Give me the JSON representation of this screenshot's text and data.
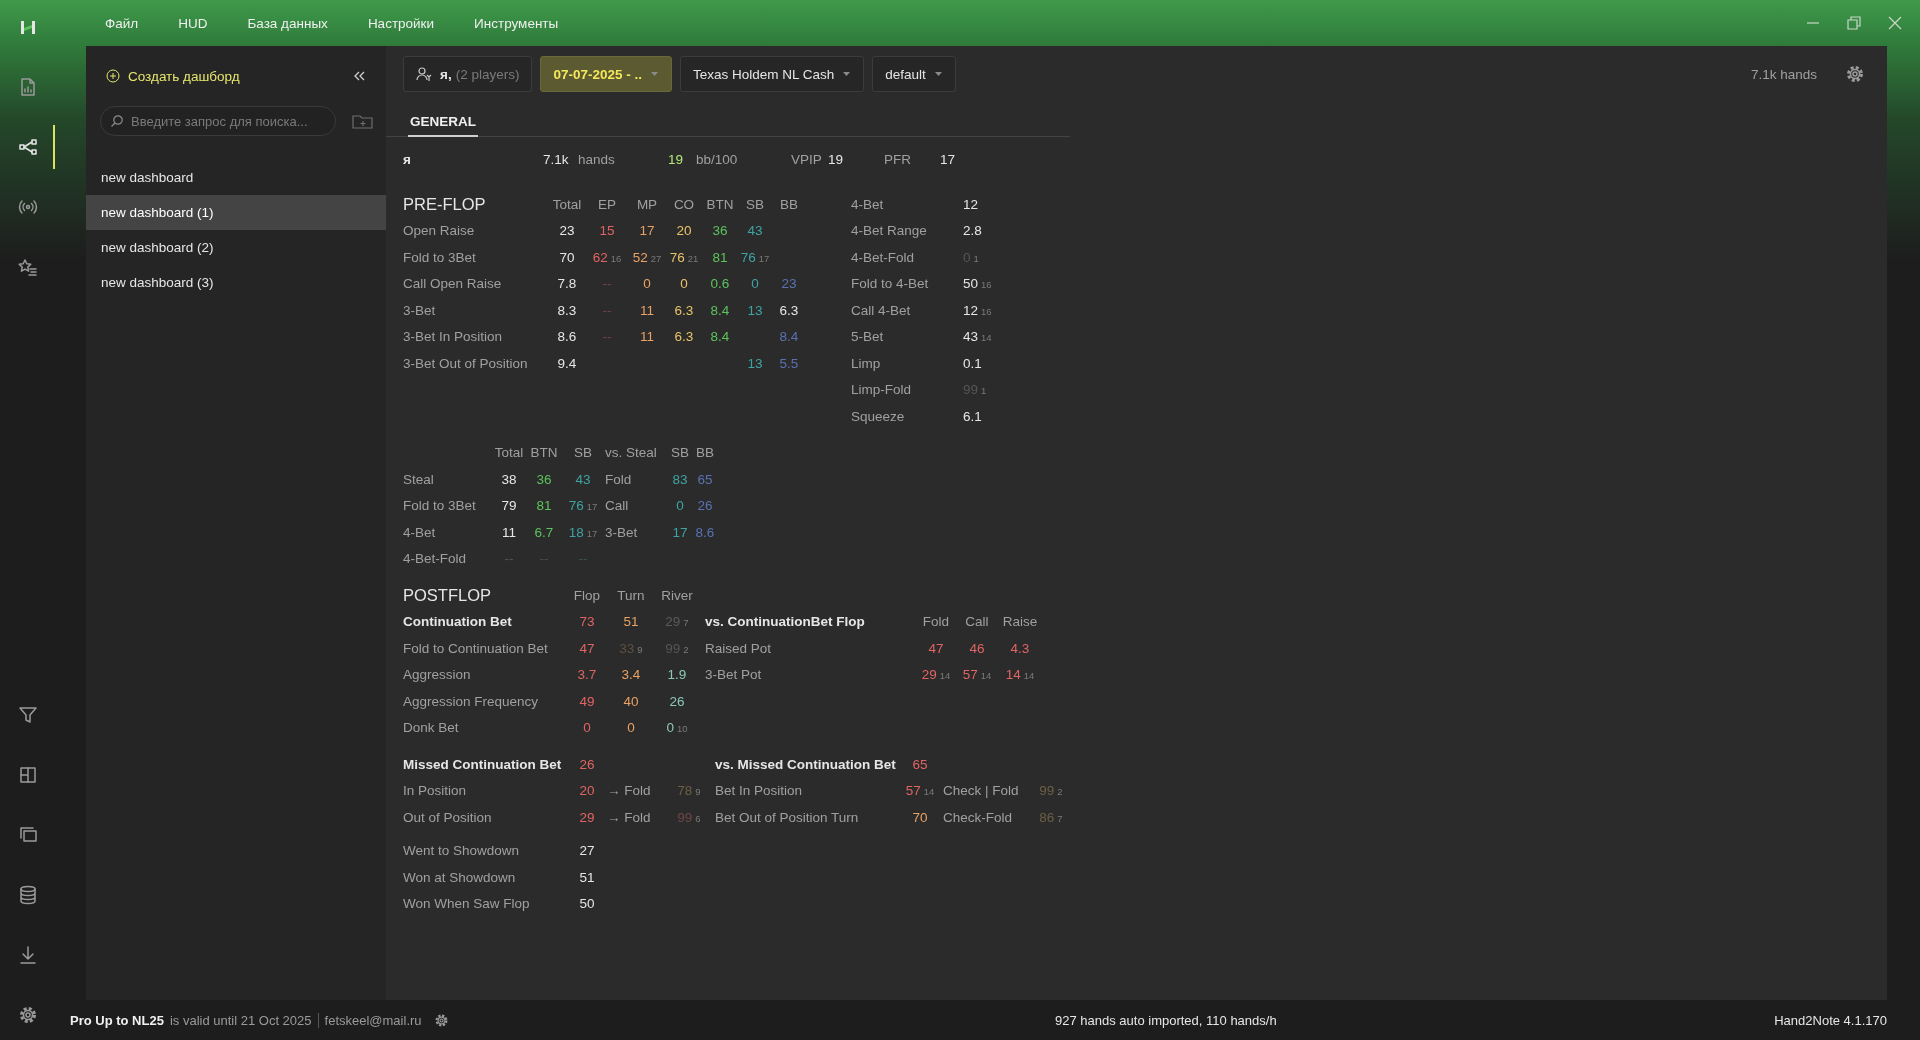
{
  "title_bar": {
    "menu": [
      "Файл",
      "HUD",
      "База данных",
      "Настройки",
      "Инструменты"
    ]
  },
  "rail": {
    "top": [
      {
        "kind": "logo",
        "selected": false
      },
      {
        "kind": "report",
        "selected": false
      },
      {
        "kind": "share",
        "selected": true
      },
      {
        "kind": "broadcast",
        "selected": false
      },
      {
        "kind": "starlist",
        "selected": false
      }
    ],
    "bottom": [
      {
        "kind": "filter",
        "selected": false
      },
      {
        "kind": "layout",
        "selected": false
      },
      {
        "kind": "copies",
        "selected": false
      },
      {
        "kind": "database",
        "selected": false
      },
      {
        "kind": "download",
        "selected": false
      },
      {
        "kind": "settings",
        "selected": false
      }
    ]
  },
  "sidebar": {
    "create_label": "Создать дашборд",
    "search": {
      "placeholder": "Введите запрос для поиска..."
    },
    "items": [
      {
        "label": "new dashboard",
        "selected": false
      },
      {
        "label": "new dashboard (1)",
        "selected": true
      },
      {
        "label": "new dashboard (2)",
        "selected": false
      },
      {
        "label": "new dashboard (3)",
        "selected": false
      }
    ]
  },
  "toolbar": {
    "player": "я,",
    "player_count": "(2 players)",
    "date": "07-07-2025 - ..",
    "game": "Texas Holdem NL Cash",
    "filter": "default",
    "hands": "7.1k hands"
  },
  "tabs": [
    {
      "label": "GENERAL",
      "selected": true
    }
  ],
  "summary": [
    {
      "text": "я",
      "kind": "name",
      "color": "#e6e6e6"
    },
    {
      "text": "7.1k",
      "kind": "value",
      "color": "#e6e6e6"
    },
    {
      "text": "hands",
      "kind": "label",
      "color": "#a0a0a0"
    },
    {
      "text": "19",
      "kind": "value",
      "color": "#b4e678"
    },
    {
      "text": "bb/100",
      "kind": "label",
      "color": "#a0a0a0"
    },
    {
      "text": "VPIP",
      "kind": "label",
      "color": "#a0a0a0"
    },
    {
      "text": "19",
      "kind": "value",
      "color": "#e6e6e6"
    },
    {
      "text": "PFR",
      "kind": "label",
      "color": "#a0a0a0"
    },
    {
      "text": "17",
      "kind": "value",
      "color": "#e6e6e6"
    }
  ],
  "preflop": {
    "title": "PRE-FLOP",
    "columns": [
      "Total",
      "EP",
      "MP",
      "CO",
      "BTN",
      "SB",
      "BB"
    ],
    "rows": [
      {
        "label": "Open Raise",
        "cells": [
          {
            "v": "23",
            "color": "#e6e6e6"
          },
          {
            "v": "15",
            "color": "#e06464"
          },
          {
            "v": "17",
            "color": "#e8a264"
          },
          {
            "v": "20",
            "color": "#e8c468"
          },
          {
            "v": "36",
            "color": "#5cc35c"
          },
          {
            "v": "43",
            "color": "#3fa3a3"
          },
          null
        ]
      },
      {
        "label": "Fold to 3Bet",
        "cells": [
          {
            "v": "70",
            "color": "#e6e6e6"
          },
          {
            "v": "62",
            "n": "16",
            "color": "#e06464"
          },
          {
            "v": "52",
            "n": "27",
            "color": "#e8a264"
          },
          {
            "v": "76",
            "n": "21",
            "color": "#e8c468"
          },
          {
            "v": "81",
            "color": "#5cc35c"
          },
          {
            "v": "76",
            "n": "17",
            "color": "#3fa3a3"
          },
          null
        ]
      },
      {
        "label": "Call Open Raise",
        "cells": [
          {
            "v": "7.8",
            "color": "#e6e6e6"
          },
          {
            "v": "--",
            "color": "#6e4646"
          },
          {
            "v": "0",
            "color": "#e8a264"
          },
          {
            "v": "0",
            "color": "#e8c468"
          },
          {
            "v": "0.6",
            "color": "#5cc35c"
          },
          {
            "v": "0",
            "color": "#3fa3a3"
          },
          {
            "v": "23",
            "color": "#5a72b4"
          }
        ]
      },
      {
        "label": "3-Bet",
        "cells": [
          {
            "v": "8.3",
            "color": "#e6e6e6"
          },
          {
            "v": "--",
            "color": "#6e4646"
          },
          {
            "v": "11",
            "color": "#e8a264"
          },
          {
            "v": "6.3",
            "color": "#e8c468"
          },
          {
            "v": "8.4",
            "color": "#5cc35c"
          },
          {
            "v": "13",
            "color": "#3fa3a3"
          },
          {
            "v": "6.3",
            "color": "#e6e6e6"
          }
        ]
      },
      {
        "label": "3-Bet In Position",
        "cells": [
          {
            "v": "8.6",
            "color": "#e6e6e6"
          },
          {
            "v": "--",
            "color": "#6e4646"
          },
          {
            "v": "11",
            "color": "#e8a264"
          },
          {
            "v": "6.3",
            "color": "#e8c468"
          },
          {
            "v": "8.4",
            "color": "#5cc35c"
          },
          null,
          {
            "v": "8.4",
            "color": "#5a72b4"
          }
        ]
      },
      {
        "label": "3-Bet Out of Position",
        "cells": [
          {
            "v": "9.4",
            "color": "#e6e6e6"
          },
          null,
          null,
          null,
          null,
          {
            "v": "13",
            "color": "#3fa3a3"
          },
          {
            "v": "5.5",
            "color": "#5a72b4"
          }
        ]
      }
    ],
    "side": [
      {
        "label": "4-Bet",
        "cell": {
          "v": "12",
          "color": "#e6e6e6"
        }
      },
      {
        "label": "4-Bet Range",
        "cell": {
          "v": "2.8",
          "color": "#e6e6e6"
        }
      },
      {
        "label": "4-Bet-Fold",
        "cell": {
          "v": "0",
          "n": "1",
          "color": "#555555"
        }
      },
      {
        "label": "Fold to 4-Bet",
        "cell": {
          "v": "50",
          "n": "16",
          "color": "#e6e6e6"
        }
      },
      {
        "label": "Call 4-Bet",
        "cell": {
          "v": "12",
          "n": "16",
          "color": "#e6e6e6"
        }
      },
      {
        "label": "5-Bet",
        "cell": {
          "v": "43",
          "n": "14",
          "color": "#e6e6e6"
        }
      },
      {
        "label": "Limp",
        "cell": {
          "v": "0.1",
          "color": "#e6e6e6"
        }
      },
      {
        "label": "Limp-Fold",
        "cell": {
          "v": "99",
          "n": "1",
          "color": "#555555"
        }
      },
      {
        "label": "Squeeze",
        "cell": {
          "v": "6.1",
          "color": "#e6e6e6"
        }
      }
    ]
  },
  "steal": {
    "columns": [
      "Total",
      "BTN",
      "SB"
    ],
    "vs_title": "vs. Steal",
    "vs_columns": [
      "SB",
      "BB"
    ],
    "rows": [
      {
        "label": "Steal",
        "cells": [
          {
            "v": "38",
            "color": "#e6e6e6"
          },
          {
            "v": "36",
            "color": "#5cc35c"
          },
          {
            "v": "43",
            "color": "#3fa3a3"
          }
        ],
        "vs_label": "Fold",
        "vs_cells": [
          {
            "v": "83",
            "color": "#3fa3a3"
          },
          {
            "v": "65",
            "color": "#5a72b4"
          }
        ]
      },
      {
        "label": "Fold to 3Bet",
        "cells": [
          {
            "v": "79",
            "color": "#e6e6e6"
          },
          {
            "v": "81",
            "color": "#5cc35c"
          },
          {
            "v": "76",
            "n": "17",
            "color": "#3fa3a3"
          }
        ],
        "vs_label": "Call",
        "vs_cells": [
          {
            "v": "0",
            "color": "#3fa3a3"
          },
          {
            "v": "26",
            "color": "#5a72b4"
          }
        ]
      },
      {
        "label": "4-Bet",
        "cells": [
          {
            "v": "11",
            "color": "#e6e6e6"
          },
          {
            "v": "6.7",
            "color": "#5cc35c"
          },
          {
            "v": "18",
            "n": "17",
            "color": "#3fa3a3"
          }
        ],
        "vs_label": "3-Bet",
        "vs_cells": [
          {
            "v": "17",
            "color": "#3fa3a3"
          },
          {
            "v": "8.6",
            "color": "#5a72b4"
          }
        ]
      },
      {
        "label": "4-Bet-Fold",
        "cells": [
          {
            "v": "--",
            "color": "#555555"
          },
          {
            "v": "--",
            "color": "#3a5a3a"
          },
          {
            "v": "--",
            "color": "#3a5656"
          }
        ]
      }
    ]
  },
  "postflop": {
    "title": "POSTFLOP",
    "columns": [
      "Flop",
      "Turn",
      "River"
    ],
    "rows": [
      {
        "label": "Continuation Bet",
        "bold": true,
        "cells": [
          {
            "v": "73",
            "color": "#e06464"
          },
          {
            "v": "51",
            "color": "#e8a264"
          },
          {
            "v": "29",
            "n": "7",
            "color": "#5a5a5a"
          }
        ]
      },
      {
        "label": "Fold to Continuation Bet",
        "bold": false,
        "cells": [
          {
            "v": "47",
            "color": "#e06464"
          },
          {
            "v": "33",
            "n": "9",
            "color": "#5e5040"
          },
          {
            "v": "99",
            "n": "2",
            "color": "#555555"
          }
        ]
      },
      {
        "label": "Aggression",
        "bold": false,
        "cells": [
          {
            "v": "3.7",
            "color": "#e06464"
          },
          {
            "v": "3.4",
            "color": "#e8a264"
          },
          {
            "v": "1.9",
            "color": "#8cc8b8"
          }
        ]
      },
      {
        "label": "Aggression Frequency",
        "bold": false,
        "cells": [
          {
            "v": "49",
            "color": "#e06464"
          },
          {
            "v": "40",
            "color": "#e8a264"
          },
          {
            "v": "26",
            "color": "#8cc8b8"
          }
        ]
      },
      {
        "label": "Donk Bet",
        "bold": false,
        "cells": [
          {
            "v": "0",
            "color": "#e06464"
          },
          {
            "v": "0",
            "color": "#e8a264"
          },
          {
            "v": "0",
            "n": "10",
            "color": "#8cc8b8"
          }
        ]
      }
    ],
    "vs": {
      "title": "vs. ContinuationBet Flop",
      "columns": [
        "Fold",
        "Call",
        "Raise"
      ],
      "rows": [
        {
          "label": "Raised Pot",
          "cells": [
            {
              "v": "47",
              "color": "#e06464"
            },
            {
              "v": "46",
              "color": "#e06464"
            },
            {
              "v": "4.3",
              "color": "#e06464"
            }
          ]
        },
        {
          "label": "3-Bet Pot",
          "cells": [
            {
              "v": "29",
              "n": "14",
              "color": "#e06464"
            },
            {
              "v": "57",
              "n": "14",
              "color": "#e06464"
            },
            {
              "v": "14",
              "n": "14",
              "color": "#e06464"
            }
          ]
        }
      ]
    }
  },
  "missed": {
    "rows": [
      {
        "label": "Missed Continuation Bet",
        "bold": true,
        "value": {
          "v": "26",
          "color": "#e06464"
        }
      },
      {
        "label": "In Position",
        "bold": false,
        "value": {
          "v": "20",
          "color": "#e06464"
        },
        "fold_label": "→ Fold",
        "fold": {
          "v": "78",
          "n": "9",
          "color": "#6e5e46"
        }
      },
      {
        "label": "Out of Position",
        "bold": false,
        "value": {
          "v": "29",
          "color": "#e06464"
        },
        "fold_label": "→ Fold",
        "fold": {
          "v": "99",
          "n": "6",
          "color": "#6e4646"
        }
      }
    ],
    "vs_rows": [
      {
        "label": "vs. Missed Continuation Bet",
        "bold": true,
        "value": {
          "v": "65",
          "color": "#e06464"
        }
      },
      {
        "label": "Bet In Position",
        "bold": false,
        "value": {
          "v": "57",
          "n": "14",
          "color": "#e06464"
        },
        "check_label": "Check | Fold",
        "check": {
          "v": "99",
          "n": "2",
          "color": "#6e5e46"
        }
      },
      {
        "label": "Bet Out of Position Turn",
        "bold": false,
        "value": {
          "v": "70",
          "color": "#e8a264"
        },
        "check_label": "Check-Fold",
        "check": {
          "v": "86",
          "n": "7",
          "color": "#6e5e46"
        }
      }
    ]
  },
  "showdown": [
    {
      "label": "Went to Showdown",
      "cell": {
        "v": "27",
        "color": "#e6e6e6"
      }
    },
    {
      "label": "Won at Showdown",
      "cell": {
        "v": "51",
        "color": "#e6e6e6"
      }
    },
    {
      "label": "Won When Saw Flop",
      "cell": {
        "v": "50",
        "color": "#e6e6e6"
      }
    }
  ],
  "status_bar": {
    "plan": "Pro Up to NL25",
    "validity": "is valid until 21 Oct 2025",
    "email": "fetskeel@mail.ru",
    "import": "927 hands auto imported, 110 hands/h",
    "version": "Hand2Note 4.1.170"
  }
}
